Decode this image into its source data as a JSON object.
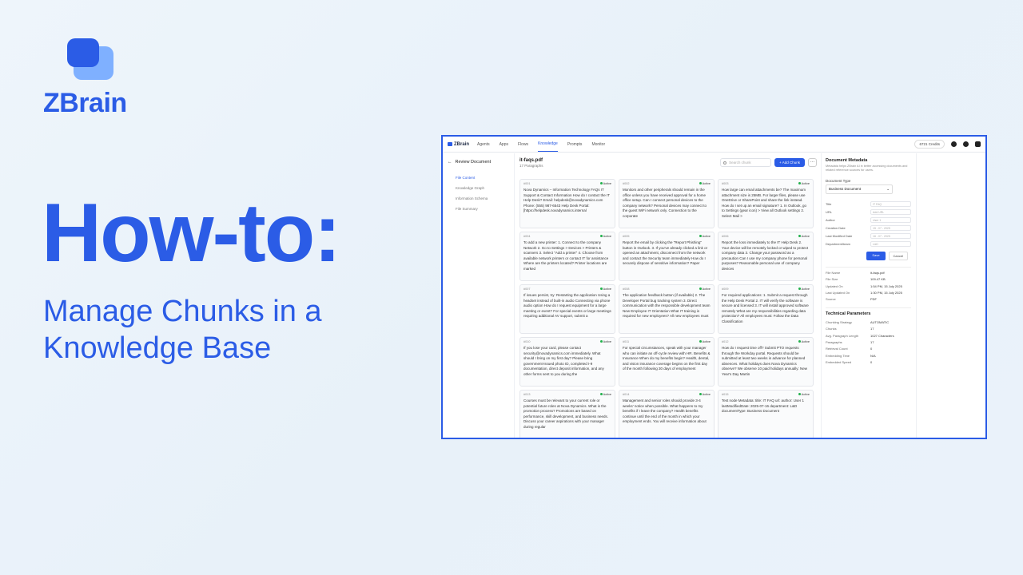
{
  "brand": {
    "name": "ZBrain"
  },
  "hero": {
    "headline": "How-to:",
    "subtitle": "Manage Chunks in a Knowledge Base"
  },
  "app": {
    "logo": "ZBrain",
    "nav": [
      "Agents",
      "Apps",
      "Flows",
      "Knowledge",
      "Prompts",
      "Monitor"
    ],
    "active_nav": "Knowledge",
    "credits": "6721 Credits"
  },
  "sidebar": {
    "back_label": "Review Document",
    "items": [
      "File Content",
      "Knowledge Graph",
      "Information Schema",
      "File Summary"
    ]
  },
  "document": {
    "title": "it-faqs.pdf",
    "subtitle": "17 Paragraphs",
    "search_placeholder": "Search chunk",
    "add_label": "+ Add Chunk",
    "more_label": "···"
  },
  "chunks": [
    {
      "id": "#001",
      "status": "Active",
      "text": "Nova Dynamics – Information Technology FAQs IT Support & Contact Information How do I contact the IT Help Desk? Email: helpdesk@novadynamics.com Phone: (555) 987-6543 Help Desk Portal: [https://helpdesk.novadynamics.internal"
    },
    {
      "id": "#002",
      "status": "Active",
      "text": "Monitors and other peripherals should remain in the office unless you have received approval for a home office setup. Can I connect personal devices to the company network? Personal devices may connect to the guest WiFi network only. Connection to the corporate"
    },
    {
      "id": "#003",
      "status": "Active",
      "text": "How large can email attachments be? The maximum attachment size is 25MB. For larger files, please use OneDrive or SharePoint and share the link instead. How do I set up an email signature? 1. In Outlook, go to Settings (gear icon) > View all Outlook settings 2. Select Mail >"
    },
    {
      "id": "#004",
      "status": "Active",
      "text": "To add a new printer: 1. Connect to the company Network 2. Go to Settings > Devices > Printers & scanners 3. Select \"Add a printer\" 4. Choose from available network printers or contact IT for assistance Where are the printers located? Printer locations are marked"
    },
    {
      "id": "#005",
      "status": "Active",
      "text": "Report the email by clicking the \"Report Phishing\" button in Outlook. 3. If you've already clicked a link or opened an attachment, disconnect from the network and contact the Security team immediately How do I securely dispose of sensitive information? Paper"
    },
    {
      "id": "#006",
      "status": "Active",
      "text": "Report the loss immediately to the IT Help Desk 2. Your device will be remotely locked or wiped to protect company data 3. Change your password as a precaution Can I use my company phone for personal purposes? Reasonable personal use of company devices"
    },
    {
      "id": "#007",
      "status": "Active",
      "text": "If issues persist, try: Restarting the application Using a headset instead of built-in audio Connecting via phone audio option How do I request equipment for a large meeting or event? For special events or large meetings requiring additional AV support, submit a"
    },
    {
      "id": "#008",
      "status": "Active",
      "text": "The application feedback button (if available) 2. The Developer Portal bug tracking system 3. Direct communication with the responsible development team New Employee IT Orientation What IT training is required for new employees? All new employees must"
    },
    {
      "id": "#009",
      "status": "Active",
      "text": "For required applications: 1. Submit a request through the Help Desk Portal 2. IT will verify the software is secure and licensed 3. IT will install approved software remotely What are my responsibilities regarding data protection? All employees must: Follow the Data Classification"
    },
    {
      "id": "#010",
      "status": "Active",
      "text": "If you lose your card, please contact security@novadynamics.com immediately. What should I bring on my first day? Please bring government-issued photo ID, completed I-9 documentation, direct deposit information, and any other forms sent to you during the"
    },
    {
      "id": "#011",
      "status": "Active",
      "text": "For special circumstances, speak with your manager who can initiate an off-cycle review with HR. Benefits & Insurance When do my benefits begin? Health, dental, and vision insurance coverage begins on the first day of the month following 30 days of employment"
    },
    {
      "id": "#012",
      "status": "Active",
      "text": "How do I request time off? Submit PTO requests through the Workday portal. Requests should be submitted at least two weeks in advance for planned absences. What holidays does Nova Dynamics observe? We observe 10 paid holidays annually: New Year's Day Martin"
    },
    {
      "id": "#013",
      "status": "Active",
      "text": "Courses must be relevant to your current role or potential future roles at Nova Dynamics. What is the promotion process? Promotions are based on performance, skill development, and business needs. Discuss your career aspirations with your manager during regular"
    },
    {
      "id": "#014",
      "status": "Active",
      "text": "Management and senior roles should provide 3-4 weeks' notice when possible. What happens to my benefits if I leave the company? Health benefits continue until the end of the month in which your employment ends. You will receive information about"
    },
    {
      "id": "#015",
      "status": "Active",
      "text": "Test node Metadata: title: IT FAQ url: author: User 1 lastModifiedDate: 2025-07-16 department: L&D documentType: Business Document"
    }
  ],
  "panel": {
    "title": "Document Metadata",
    "desc": "Metadata helps ZBrain AI in better accessing documents and related reference sources for users.",
    "type_label": "Document Type",
    "type_value": "Business Document",
    "fields": [
      {
        "k": "Title",
        "v": "IT FAQ"
      },
      {
        "k": "URL",
        "v": "Add URL"
      },
      {
        "k": "Author",
        "v": "User 1"
      },
      {
        "k": "Creation Date",
        "v": "15 - 07 - 2025"
      },
      {
        "k": "Last Modified Date",
        "v": "16 - 07 - 2025"
      },
      {
        "k": "Department/team",
        "v": "L&D"
      }
    ],
    "save": "Save",
    "cancel": "Cancel",
    "info": [
      {
        "k": "File Name",
        "v": "it-faqs.pdf"
      },
      {
        "k": "File Size",
        "v": "109.47 KB"
      },
      {
        "k": "Updated On",
        "v": "1:54 PM, 15 July 2025"
      },
      {
        "k": "Last Updated On",
        "v": "1:30 PM, 15 July 2025"
      },
      {
        "k": "Source",
        "v": "PDF"
      }
    ],
    "tech_title": "Technical Parameters",
    "tech": [
      {
        "k": "Chunking Strategy",
        "v": "AUTOMATIC"
      },
      {
        "k": "Chunks",
        "v": "17"
      },
      {
        "k": "Avg. Paragraph Length",
        "v": "1027 Characters"
      },
      {
        "k": "Paragraphs",
        "v": "17"
      },
      {
        "k": "Retrieval Count",
        "v": "0"
      },
      {
        "k": "Embedding Time",
        "v": "N/A"
      },
      {
        "k": "Embedded Speed",
        "v": "0"
      }
    ]
  },
  "colors": {
    "accent": "#2b5ce6",
    "active": "#22b14c"
  }
}
